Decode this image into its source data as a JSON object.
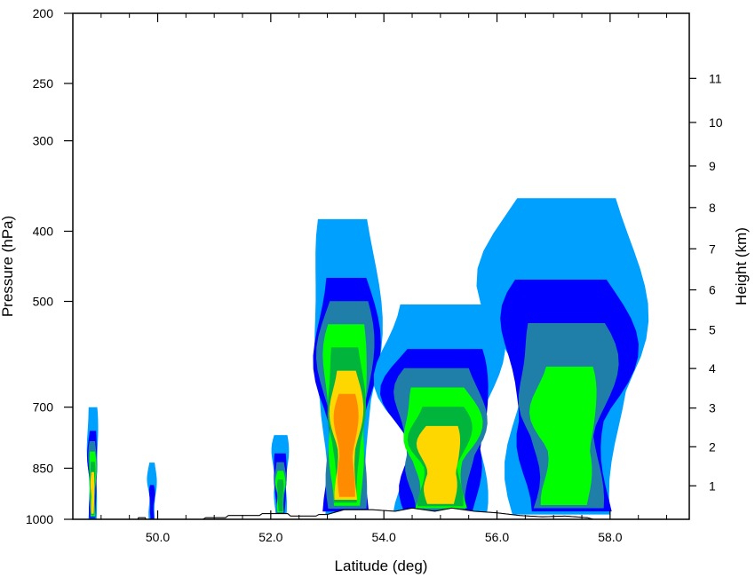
{
  "chart_data": {
    "type": "contour",
    "xlabel": "Latitude (deg)",
    "ylabel": "Pressure (hPa)",
    "ylabel_right": "Height (km)",
    "xlim": [
      48.5,
      59.4
    ],
    "x_ticks": [
      50.0,
      52.0,
      54.0,
      56.0,
      58.0
    ],
    "x_tick_labels": [
      "50.0",
      "52.0",
      "54.0",
      "56.0",
      "58.0"
    ],
    "y_scale": "log",
    "ylim": [
      1000,
      200
    ],
    "y_ticks": [
      200,
      250,
      300,
      400,
      500,
      700,
      850,
      1000
    ],
    "y_tick_labels": [
      "200",
      "250",
      "300",
      "400",
      "500",
      "700",
      "850",
      "1000"
    ],
    "right_ticks_km": [
      1,
      2,
      3,
      4,
      5,
      6,
      7,
      8,
      9,
      10,
      11
    ],
    "right_tick_pressure": [
      899,
      794,
      702,
      619,
      547,
      482,
      423,
      371,
      325,
      283,
      246
    ],
    "right_tick_labels": [
      "1",
      "2",
      "3",
      "4",
      "5",
      "6",
      "7",
      "8",
      "9",
      "10",
      "11"
    ],
    "level_colors": [
      "#00a0ff",
      "#0000ff",
      "#1f7fa8",
      "#00ff00",
      "#00b43c",
      "#ffd700",
      "#ff8c00"
    ],
    "levels": [
      1,
      2,
      3,
      4,
      5,
      6,
      7
    ],
    "cells": [
      {
        "name": "cell-48.9",
        "x": [
          48.75,
          48.95
        ],
        "top": 700,
        "base": 1000,
        "max_level": 6
      },
      {
        "name": "cell-49.9",
        "x": [
          49.82,
          49.98
        ],
        "top": 835,
        "base": 1000,
        "max_level": 2
      },
      {
        "name": "cell-52.2",
        "x": [
          52.02,
          52.32
        ],
        "top": 765,
        "base": 985,
        "max_level": 5
      },
      {
        "name": "cell-53.5",
        "x": [
          52.72,
          53.95
        ],
        "top": 385,
        "base": 985,
        "max_level": 7
      },
      {
        "name": "cell-55.0",
        "x": [
          53.9,
          56.1
        ],
        "top": 505,
        "base": 985,
        "max_level": 6
      },
      {
        "name": "cell-57.0",
        "x": [
          55.8,
          58.65
        ],
        "top": 360,
        "base": 985,
        "max_level": 4
      }
    ],
    "terrain": [
      [
        48.5,
        1000
      ],
      [
        49.65,
        1000
      ],
      [
        49.66,
        995
      ],
      [
        49.78,
        995
      ],
      [
        49.79,
        1000
      ],
      [
        50.8,
        1000
      ],
      [
        50.85,
        995
      ],
      [
        51.2,
        995
      ],
      [
        51.25,
        988
      ],
      [
        51.8,
        988
      ],
      [
        51.85,
        982
      ],
      [
        52.3,
        982
      ],
      [
        52.35,
        990
      ],
      [
        52.8,
        990
      ],
      [
        52.85,
        985
      ],
      [
        53.0,
        985
      ],
      [
        53.3,
        970
      ],
      [
        53.8,
        970
      ],
      [
        54.2,
        975
      ],
      [
        54.5,
        965
      ],
      [
        54.9,
        975
      ],
      [
        55.2,
        965
      ],
      [
        55.6,
        975
      ],
      [
        56.0,
        980
      ],
      [
        56.4,
        988
      ],
      [
        56.8,
        992
      ],
      [
        57.2,
        990
      ],
      [
        57.6,
        995
      ],
      [
        57.7,
        1000
      ],
      [
        59.4,
        1000
      ]
    ]
  }
}
